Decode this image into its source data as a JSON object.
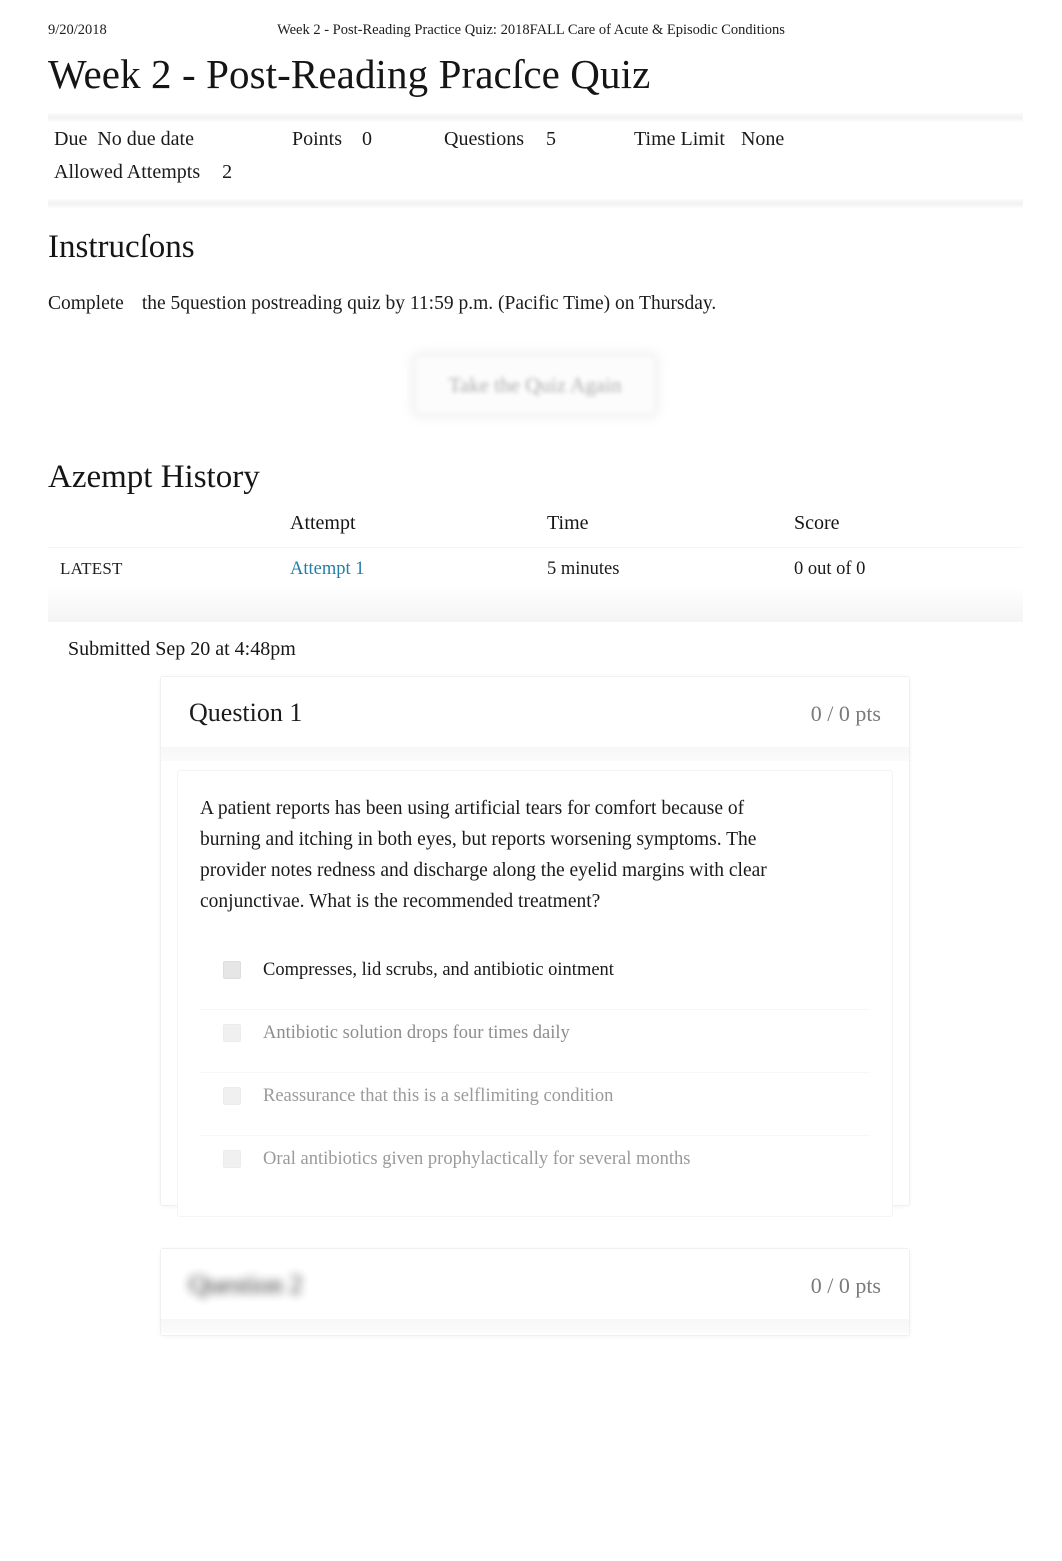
{
  "print_header": {
    "date": "9/20/2018",
    "document_title": "Week 2 - Post-Reading Practice Quiz: 2018FALL Care of Acute & Episodic Conditions"
  },
  "quiz": {
    "title": "Week 2 - Post-Reading Pracſce Quiz",
    "meta": {
      "due_label": "Due",
      "due_value": "No due date",
      "points_label": "Points",
      "points_value": "0",
      "questions_label": "Questions",
      "questions_value": "5",
      "time_limit_label": "Time Limit",
      "time_limit_value": "None",
      "allowed_attempts_label": "Allowed Attempts",
      "allowed_attempts_value": "2"
    }
  },
  "instructions": {
    "heading": "Instrucſons",
    "text_part1": "Complete",
    "text_part2": "the 5question postreading quiz by 11:59 p.m. (Pacific Time) on Thursday."
  },
  "retake": {
    "label": "Take the Quiz Again"
  },
  "attempt_history": {
    "heading": "Azempt History",
    "columns": [
      "",
      "Attempt",
      "Time",
      "Score"
    ],
    "rows": [
      {
        "kept": "LATEST",
        "attempt": "Attempt 1",
        "time": "5 minutes",
        "score": "0 out of 0"
      }
    ]
  },
  "submission": {
    "submitted_text": "Submitted Sep 20 at 4:48pm"
  },
  "questions": [
    {
      "name": "Question 1",
      "points": "0 / 0 pts",
      "text": "A patient reports has been using artificial tears for comfort because of burning and itching in both eyes, but reports worsening symptoms. The provider notes redness and discharge along the eyelid margins with clear conjunctivae. What is the recommended treatment?",
      "answers": [
        {
          "text": "Compresses, lid scrubs, and antibiotic ointment",
          "selected": true
        },
        {
          "text": "Antibiotic solution drops four times daily",
          "selected": false
        },
        {
          "text": "Reassurance that this is a selflimiting condition",
          "selected": false
        },
        {
          "text": "Oral antibiotics given prophylactically for several months",
          "selected": false
        }
      ]
    },
    {
      "name": "Question 2",
      "points": "0 / 0 pts",
      "text": "",
      "answers": []
    }
  ],
  "colors": {
    "link": "#1f7fa8",
    "text": "#1a1a1a",
    "muted": "#8d8d8d",
    "points_muted": "#7a7a7a",
    "band": "#f4f4f4"
  }
}
